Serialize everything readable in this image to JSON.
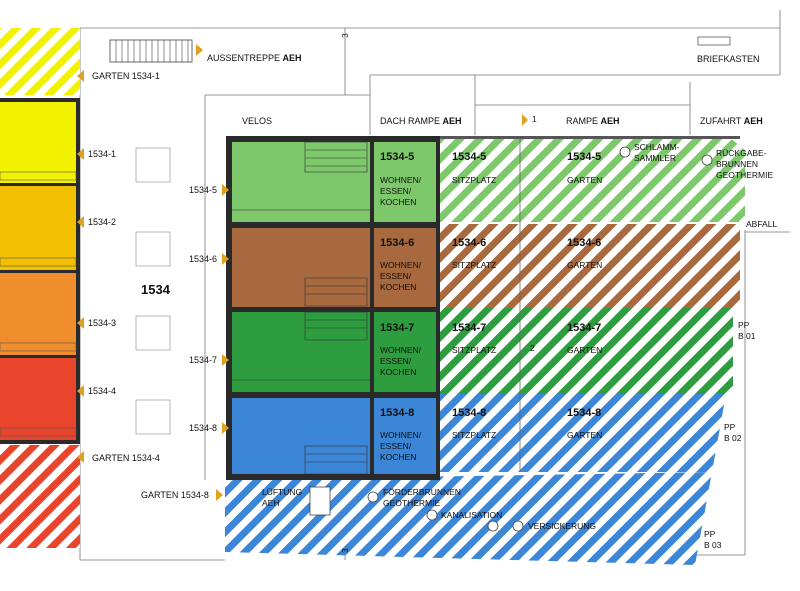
{
  "colors": {
    "unit_1534_1": "#f2f200",
    "unit_1534_2": "#f2c000",
    "unit_1534_3": "#ef8c2c",
    "unit_1534_4": "#e8452c",
    "unit_1534_5": "#7cc86a",
    "unit_1534_6": "#a8693e",
    "unit_1534_7": "#2e9d40",
    "unit_1534_8": "#3c86d8",
    "marker": "#e0a020"
  },
  "top": {
    "aussentreppe": "AUSSENTREPPE",
    "aeh": "AEH",
    "garten_1534_1": "GARTEN 1534-1",
    "briefkasten": "BRIEFKASTEN",
    "velos": "VELOS",
    "dach_rampe": "DACH RAMPE",
    "rampe": "RAMPE",
    "zufahrt": "ZUFAHRT",
    "step_3": "3",
    "step_1": "1"
  },
  "left_block": {
    "building_number": "1534",
    "units": [
      "1534-1",
      "1534-2",
      "1534-3",
      "1534-4"
    ],
    "garten_1534_4": "GARTEN 1534-4"
  },
  "units": [
    {
      "id": "1534-5",
      "entry": "1534-5",
      "room": [
        "WOHNEN/",
        "ESSEN/",
        "KOCHEN"
      ],
      "sitzplatz": "SITZPLATZ",
      "garten": "GARTEN"
    },
    {
      "id": "1534-6",
      "entry": "1534-6",
      "room": [
        "WOHNEN/",
        "ESSEN/",
        "KOCHEN"
      ],
      "sitzplatz": "SITZPLATZ",
      "garten": "GARTEN"
    },
    {
      "id": "1534-7",
      "entry": "1534-7",
      "room": [
        "WOHNEN/",
        "ESSEN/",
        "KOCHEN"
      ],
      "sitzplatz": "SITZPLATZ",
      "garten": "GARTEN"
    },
    {
      "id": "1534-8",
      "entry": "1534-8",
      "room": [
        "WOHNEN/",
        "ESSEN/",
        "KOCHEN"
      ],
      "sitzplatz": "SITZPLATZ",
      "garten": "GARTEN"
    }
  ],
  "right": {
    "schlamm": [
      "SCHLAMM-",
      "SAMMLER"
    ],
    "rueckgabe": [
      "RÜCKGABE-",
      "BRUNNEN",
      "GEOTHERMIE"
    ],
    "abfall": "ABFALL",
    "pp_b01": [
      "PP",
      "B 01"
    ],
    "pp_b02": [
      "PP",
      "B 02"
    ],
    "pp_b03": [
      "PP",
      "B 03"
    ],
    "step_2": "2"
  },
  "bottom": {
    "garten_1534_8": "GARTEN 1534-8",
    "lueftung": [
      "LÜFTUNG",
      "AEH"
    ],
    "foerderbrunnen": [
      "FÖRDERBRUNNEN",
      "GEOTHERMIE"
    ],
    "kanalisation": "KANALISATION",
    "versickerung": "VERSICKERUNG",
    "step_3": "3"
  }
}
